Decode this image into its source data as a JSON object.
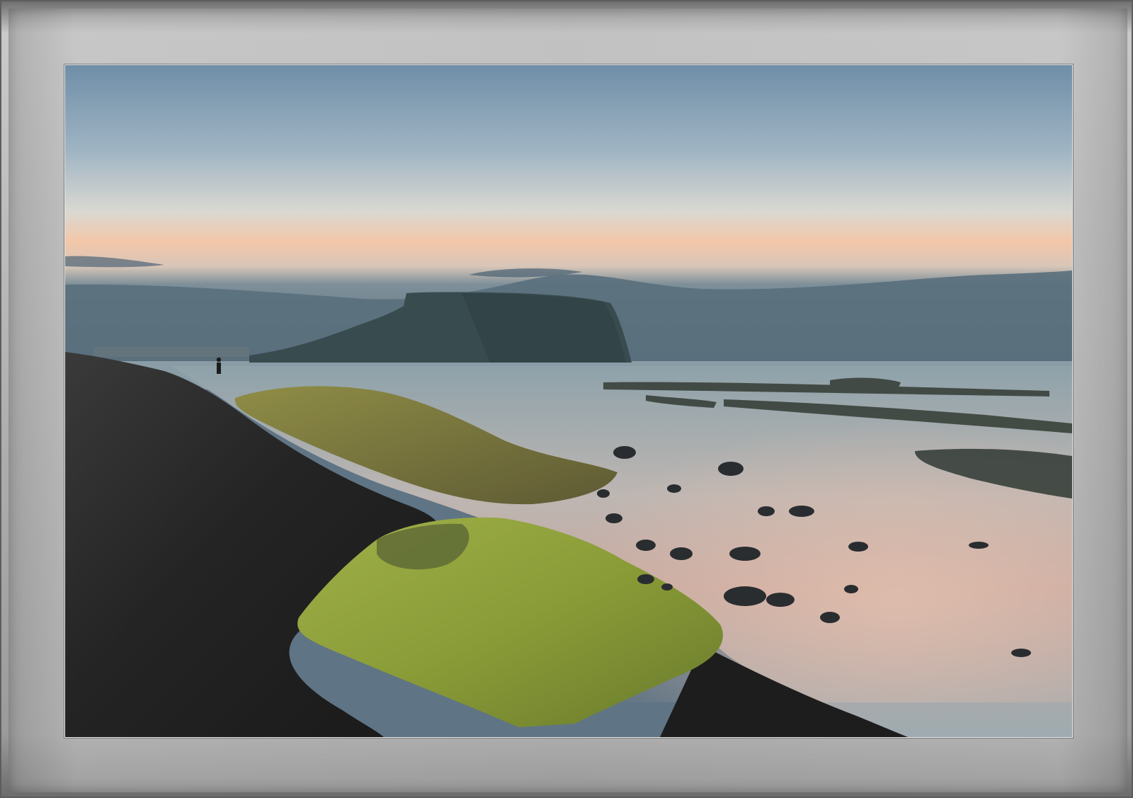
{
  "image": {
    "subject": "coastal-rock-formation",
    "frame_style": "gray-beveled-border"
  },
  "colors": {
    "frame": "#b4b4b4",
    "sky_top": "#6f8ea8",
    "sky_glow": "#f3c7a8",
    "mountain": "#384b4f",
    "sand": "#272727",
    "moss": "#8fa23c",
    "water": "#a8b1b4"
  }
}
